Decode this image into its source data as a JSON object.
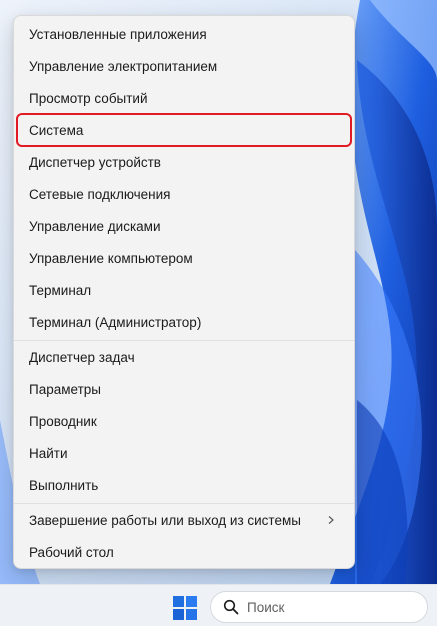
{
  "context_menu": {
    "items": [
      {
        "label": "Установленные приложения"
      },
      {
        "label": "Управление электропитанием"
      },
      {
        "label": "Просмотр событий"
      },
      {
        "label": "Система"
      },
      {
        "label": "Диспетчер устройств"
      },
      {
        "label": "Сетевые подключения"
      },
      {
        "label": "Управление дисками"
      },
      {
        "label": "Управление компьютером"
      },
      {
        "label": "Терминал"
      },
      {
        "label": "Терминал (Администратор)"
      },
      {
        "label": "Диспетчер задач"
      },
      {
        "label": "Параметры"
      },
      {
        "label": "Проводник"
      },
      {
        "label": "Найти"
      },
      {
        "label": "Выполнить"
      },
      {
        "label": "Завершение работы или выход из системы"
      },
      {
        "label": "Рабочий стол"
      }
    ],
    "highlight_color": "#e01b24"
  },
  "taskbar": {
    "search_placeholder": "Поиск",
    "start_icon": "windows-logo-icon",
    "accent": "#1f6fe0"
  }
}
